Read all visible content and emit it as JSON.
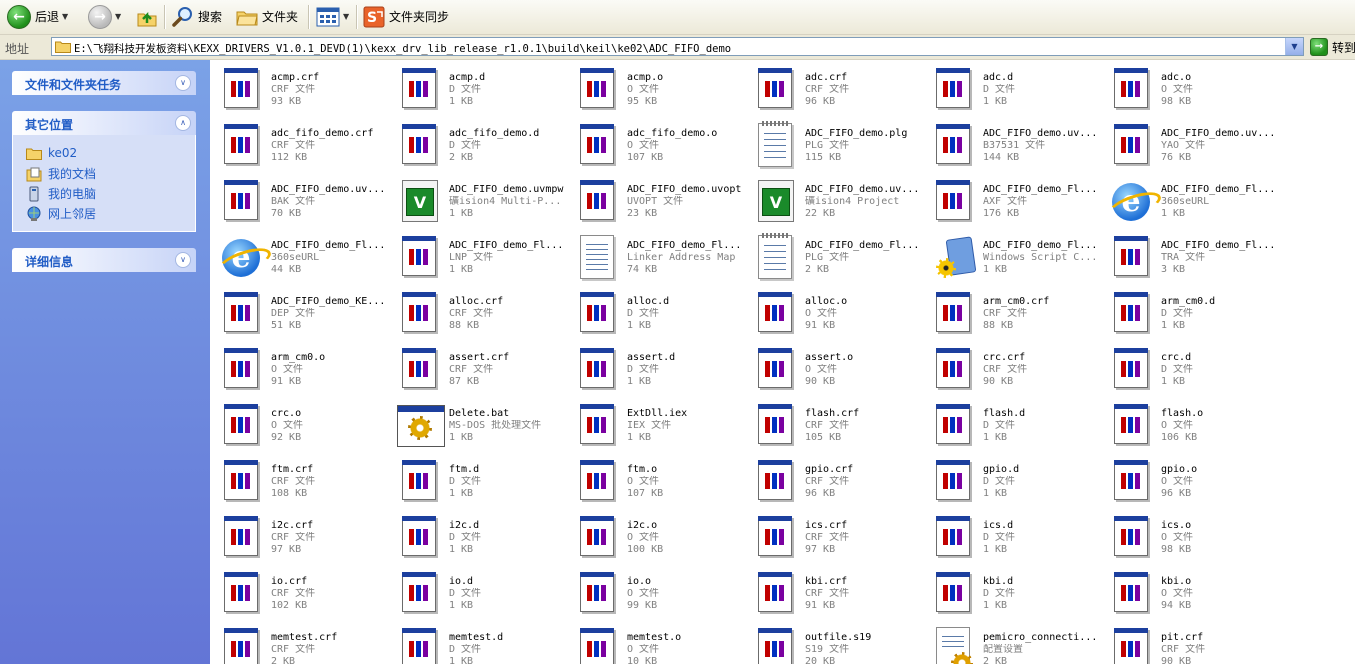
{
  "toolbar": {
    "back_label": "后退",
    "search_label": "搜索",
    "folders_label": "文件夹",
    "sync_label": "文件夹同步"
  },
  "address": {
    "label": "地址",
    "path": "E:\\飞翔科技开发板资料\\KEXX_DRIVERS_V1.0.1_DEVD(1)\\kexx_drv_lib_release_r1.0.1\\build\\keil\\ke02\\ADC_FIFO_demo",
    "go_label": "转到"
  },
  "sidebar": {
    "tasks_title": "文件和文件夹任务",
    "places_title": "其它位置",
    "places": [
      "ke02",
      "我的文档",
      "我的电脑",
      "网上邻居"
    ],
    "details_title": "详细信息"
  },
  "files": [
    {
      "name": "acmp.crf",
      "type": "CRF 文件",
      "size": "93 KB",
      "icon": "window-app-icon"
    },
    {
      "name": "acmp.d",
      "type": "D 文件",
      "size": "1 KB",
      "icon": "window-app-icon"
    },
    {
      "name": "acmp.o",
      "type": "O 文件",
      "size": "95 KB",
      "icon": "window-app-icon"
    },
    {
      "name": "adc.crf",
      "type": "CRF 文件",
      "size": "96 KB",
      "icon": "window-app-icon"
    },
    {
      "name": "adc.d",
      "type": "D 文件",
      "size": "1 KB",
      "icon": "window-app-icon"
    },
    {
      "name": "adc.o",
      "type": "O 文件",
      "size": "98 KB",
      "icon": "window-app-icon"
    },
    {
      "name": "adc_fifo_demo.crf",
      "type": "CRF 文件",
      "size": "112 KB",
      "icon": "window-app-icon"
    },
    {
      "name": "adc_fifo_demo.d",
      "type": "D 文件",
      "size": "2 KB",
      "icon": "window-app-icon"
    },
    {
      "name": "adc_fifo_demo.o",
      "type": "O 文件",
      "size": "107 KB",
      "icon": "window-app-icon"
    },
    {
      "name": "ADC_FIFO_demo.plg",
      "type": "PLG 文件",
      "size": "115 KB",
      "icon": "notepad-icon"
    },
    {
      "name": "ADC_FIFO_demo.uv...",
      "type": "B37531 文件",
      "size": "144 KB",
      "icon": "window-app-icon"
    },
    {
      "name": "ADC_FIFO_demo.uv...",
      "type": "YAO 文件",
      "size": "76 KB",
      "icon": "window-app-icon"
    },
    {
      "name": "ADC_FIFO_demo.uv...",
      "type": "BAK 文件",
      "size": "70 KB",
      "icon": "window-app-icon"
    },
    {
      "name": "ADC_FIFO_demo.uvmpw",
      "type": "礦ision4 Multi-P...",
      "size": "1 KB",
      "icon": "uvision-icon"
    },
    {
      "name": "ADC_FIFO_demo.uvopt",
      "type": "UVOPT 文件",
      "size": "23 KB",
      "icon": "window-app-icon"
    },
    {
      "name": "ADC_FIFO_demo.uv...",
      "type": "礦ision4 Project",
      "size": "22 KB",
      "icon": "uvision-icon"
    },
    {
      "name": "ADC_FIFO_demo_Fl...",
      "type": "AXF 文件",
      "size": "176 KB",
      "icon": "window-app-icon"
    },
    {
      "name": "ADC_FIFO_demo_Fl...",
      "type": "360seURL",
      "size": "1 KB",
      "icon": "ie-icon"
    },
    {
      "name": "ADC_FIFO_demo_Fl...",
      "type": "360seURL",
      "size": "44 KB",
      "icon": "ie-icon"
    },
    {
      "name": "ADC_FIFO_demo_Fl...",
      "type": "LNP 文件",
      "size": "1 KB",
      "icon": "window-app-icon"
    },
    {
      "name": "ADC_FIFO_demo_Fl...",
      "type": "Linker Address Map",
      "size": "74 KB",
      "icon": "text-doc-icon"
    },
    {
      "name": "ADC_FIFO_demo_Fl...",
      "type": "PLG 文件",
      "size": "2 KB",
      "icon": "notepad-icon"
    },
    {
      "name": "ADC_FIFO_demo_Fl...",
      "type": "Windows Script C...",
      "size": "1 KB",
      "icon": "script-gear-icon"
    },
    {
      "name": "ADC_FIFO_demo_Fl...",
      "type": "TRA 文件",
      "size": "3 KB",
      "icon": "window-app-icon"
    },
    {
      "name": "ADC_FIFO_demo_KE...",
      "type": "DEP 文件",
      "size": "51 KB",
      "icon": "window-app-icon"
    },
    {
      "name": "alloc.crf",
      "type": "CRF 文件",
      "size": "88 KB",
      "icon": "window-app-icon"
    },
    {
      "name": "alloc.d",
      "type": "D 文件",
      "size": "1 KB",
      "icon": "window-app-icon"
    },
    {
      "name": "alloc.o",
      "type": "O 文件",
      "size": "91 KB",
      "icon": "window-app-icon"
    },
    {
      "name": "arm_cm0.crf",
      "type": "CRF 文件",
      "size": "88 KB",
      "icon": "window-app-icon"
    },
    {
      "name": "arm_cm0.d",
      "type": "D 文件",
      "size": "1 KB",
      "icon": "window-app-icon"
    },
    {
      "name": "arm_cm0.o",
      "type": "O 文件",
      "size": "91 KB",
      "icon": "window-app-icon"
    },
    {
      "name": "assert.crf",
      "type": "CRF 文件",
      "size": "87 KB",
      "icon": "window-app-icon"
    },
    {
      "name": "assert.d",
      "type": "D 文件",
      "size": "1 KB",
      "icon": "window-app-icon"
    },
    {
      "name": "assert.o",
      "type": "O 文件",
      "size": "90 KB",
      "icon": "window-app-icon"
    },
    {
      "name": "crc.crf",
      "type": "CRF 文件",
      "size": "90 KB",
      "icon": "window-app-icon"
    },
    {
      "name": "crc.d",
      "type": "D 文件",
      "size": "1 KB",
      "icon": "window-app-icon"
    },
    {
      "name": "crc.o",
      "type": "O 文件",
      "size": "92 KB",
      "icon": "window-app-icon"
    },
    {
      "name": "Delete.bat",
      "type": "MS-DOS 批处理文件",
      "size": "1 KB",
      "icon": "batch-file-icon"
    },
    {
      "name": "ExtDll.iex",
      "type": "IEX 文件",
      "size": "1 KB",
      "icon": "window-app-icon"
    },
    {
      "name": "flash.crf",
      "type": "CRF 文件",
      "size": "105 KB",
      "icon": "window-app-icon"
    },
    {
      "name": "flash.d",
      "type": "D 文件",
      "size": "1 KB",
      "icon": "window-app-icon"
    },
    {
      "name": "flash.o",
      "type": "O 文件",
      "size": "106 KB",
      "icon": "window-app-icon"
    },
    {
      "name": "ftm.crf",
      "type": "CRF 文件",
      "size": "108 KB",
      "icon": "window-app-icon"
    },
    {
      "name": "ftm.d",
      "type": "D 文件",
      "size": "1 KB",
      "icon": "window-app-icon"
    },
    {
      "name": "ftm.o",
      "type": "O 文件",
      "size": "107 KB",
      "icon": "window-app-icon"
    },
    {
      "name": "gpio.crf",
      "type": "CRF 文件",
      "size": "96 KB",
      "icon": "window-app-icon"
    },
    {
      "name": "gpio.d",
      "type": "D 文件",
      "size": "1 KB",
      "icon": "window-app-icon"
    },
    {
      "name": "gpio.o",
      "type": "O 文件",
      "size": "96 KB",
      "icon": "window-app-icon"
    },
    {
      "name": "i2c.crf",
      "type": "CRF 文件",
      "size": "97 KB",
      "icon": "window-app-icon"
    },
    {
      "name": "i2c.d",
      "type": "D 文件",
      "size": "1 KB",
      "icon": "window-app-icon"
    },
    {
      "name": "i2c.o",
      "type": "O 文件",
      "size": "100 KB",
      "icon": "window-app-icon"
    },
    {
      "name": "ics.crf",
      "type": "CRF 文件",
      "size": "97 KB",
      "icon": "window-app-icon"
    },
    {
      "name": "ics.d",
      "type": "D 文件",
      "size": "1 KB",
      "icon": "window-app-icon"
    },
    {
      "name": "ics.o",
      "type": "O 文件",
      "size": "98 KB",
      "icon": "window-app-icon"
    },
    {
      "name": "io.crf",
      "type": "CRF 文件",
      "size": "102 KB",
      "icon": "window-app-icon"
    },
    {
      "name": "io.d",
      "type": "D 文件",
      "size": "1 KB",
      "icon": "window-app-icon"
    },
    {
      "name": "io.o",
      "type": "O 文件",
      "size": "99 KB",
      "icon": "window-app-icon"
    },
    {
      "name": "kbi.crf",
      "type": "CRF 文件",
      "size": "91 KB",
      "icon": "window-app-icon"
    },
    {
      "name": "kbi.d",
      "type": "D 文件",
      "size": "1 KB",
      "icon": "window-app-icon"
    },
    {
      "name": "kbi.o",
      "type": "O 文件",
      "size": "94 KB",
      "icon": "window-app-icon"
    },
    {
      "name": "memtest.crf",
      "type": "CRF 文件",
      "size": "2 KB",
      "icon": "window-app-icon"
    },
    {
      "name": "memtest.d",
      "type": "D 文件",
      "size": "1 KB",
      "icon": "window-app-icon"
    },
    {
      "name": "memtest.o",
      "type": "O 文件",
      "size": "10 KB",
      "icon": "window-app-icon"
    },
    {
      "name": "outfile.s19",
      "type": "S19 文件",
      "size": "20 KB",
      "icon": "window-app-icon"
    },
    {
      "name": "pemicro_connecti...",
      "type": "配置设置",
      "size": "2 KB",
      "icon": "config-file-icon"
    },
    {
      "name": "pit.crf",
      "type": "CRF 文件",
      "size": "90 KB",
      "icon": "window-app-icon"
    }
  ]
}
